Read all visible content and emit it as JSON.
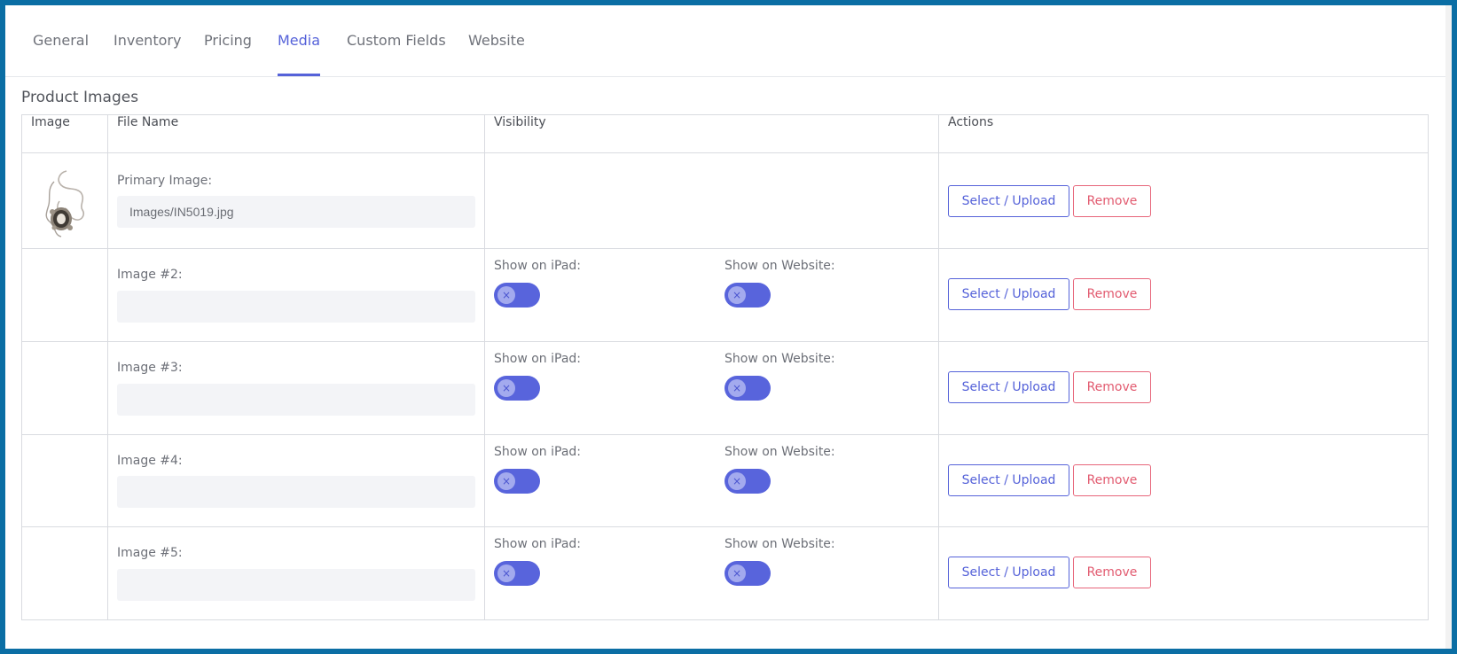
{
  "tabs": [
    {
      "label": "General",
      "active": false
    },
    {
      "label": "Inventory",
      "active": false
    },
    {
      "label": "Pricing",
      "active": false
    },
    {
      "label": "Media",
      "active": true
    },
    {
      "label": "Custom Fields",
      "active": false
    },
    {
      "label": "Website",
      "active": false
    }
  ],
  "section_title": "Product Images",
  "table": {
    "headers": [
      "Image",
      "File Name",
      "Visibility",
      "Actions"
    ],
    "rows": [
      {
        "label": "Primary Image:",
        "value": "Images/IN5019.jpg",
        "has_thumbnail": true,
        "ipad_label": "",
        "web_label": ""
      },
      {
        "label": "Image #2:",
        "value": "",
        "ipad_label": "Show on iPad:",
        "web_label": "Show on Website:"
      },
      {
        "label": "Image #3:",
        "value": "",
        "ipad_label": "Show on iPad:",
        "web_label": "Show on Website:"
      },
      {
        "label": "Image #4:",
        "value": "",
        "ipad_label": "Show on iPad:",
        "web_label": "Show on Website:"
      },
      {
        "label": "Image #5:",
        "value": "",
        "ipad_label": "Show on iPad:",
        "web_label": "Show on Website:"
      }
    ]
  },
  "actions": {
    "upload_label": "Select / Upload",
    "remove_label": "Remove"
  },
  "toggle_glyph": "×",
  "colors": {
    "accent": "#5562d9",
    "danger": "#e25b70",
    "frame": "#0b6ea4",
    "input_bg": "#f3f4f7"
  }
}
